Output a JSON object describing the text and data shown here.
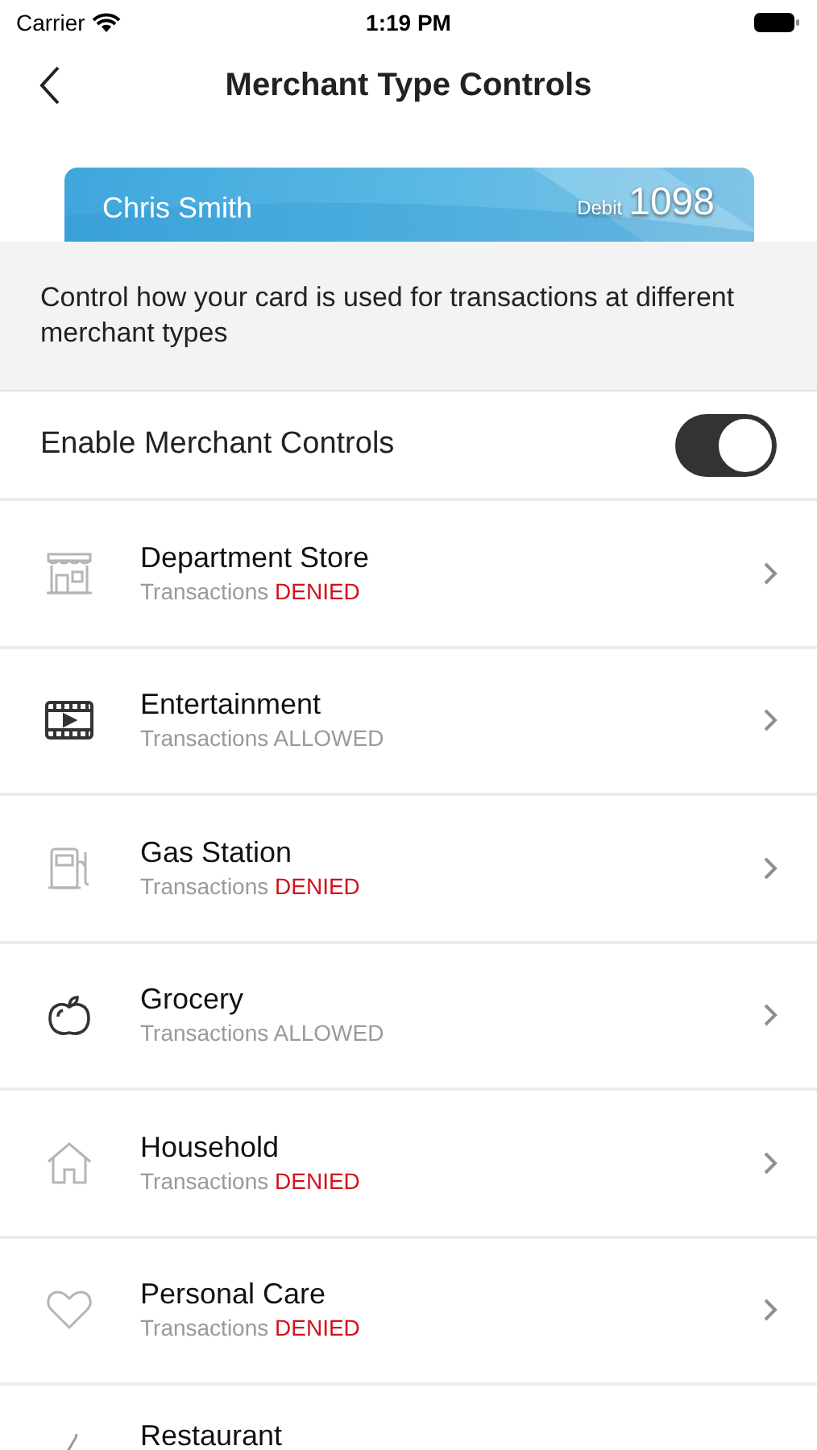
{
  "status_bar": {
    "carrier": "Carrier",
    "time": "1:19 PM"
  },
  "nav": {
    "title": "Merchant Type Controls"
  },
  "card": {
    "holder": "Chris Smith",
    "type": "Debit",
    "last_digits": "1098"
  },
  "description": "Control how your card is used for transactions at different merchant types",
  "master_toggle": {
    "label": "Enable Merchant Controls",
    "on": true
  },
  "merchants": [
    {
      "kind": "row",
      "name": "Department Store",
      "prefix": "Transactions",
      "status": "DENIED",
      "allowed": false
    },
    {
      "kind": "row",
      "name": "Entertainment",
      "prefix": "Transactions",
      "status": "ALLOWED",
      "allowed": true
    },
    {
      "kind": "row",
      "name": "Gas Station",
      "prefix": "Transactions",
      "status": "DENIED",
      "allowed": false
    },
    {
      "kind": "row",
      "name": "Grocery",
      "prefix": "Transactions",
      "status": "ALLOWED",
      "allowed": true
    },
    {
      "kind": "row",
      "name": "Household",
      "prefix": "Transactions",
      "status": "DENIED",
      "allowed": false
    },
    {
      "kind": "row",
      "name": "Personal Care",
      "prefix": "Transactions",
      "status": "DENIED",
      "allowed": false
    },
    {
      "kind": "cut",
      "name": "Restaurant"
    }
  ]
}
